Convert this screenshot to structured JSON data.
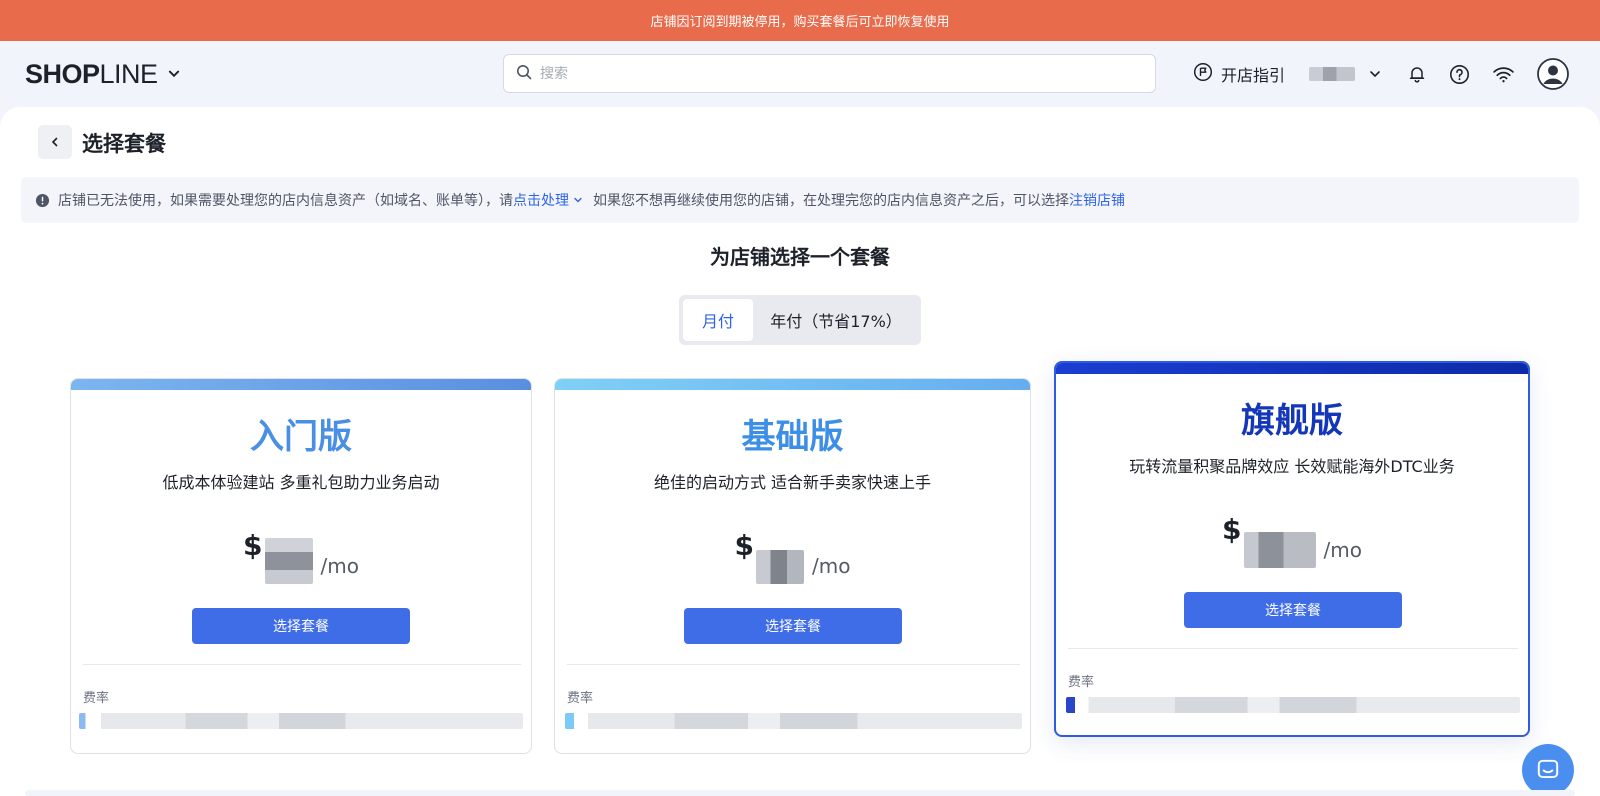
{
  "banner": {
    "text": "店铺因订阅到期被停用，购买套餐后可立即恢复使用"
  },
  "header": {
    "logo_bold": "SHOP",
    "logo_thin": "LINE",
    "search_placeholder": "搜索",
    "guide_label": "开店指引"
  },
  "page": {
    "title": "选择套餐"
  },
  "notice": {
    "text_before": "店铺已无法使用，如果需要处理您的店内信息资产（如域名、账单等），请",
    "action_link": "点击处理",
    "text_middle": "如果您不想再继续使用您的店铺，在处理完您的店内信息资产之后，可以选择",
    "close_link": "注销店铺"
  },
  "plans_section": {
    "title": "为店铺选择一个套餐",
    "billing_toggle": {
      "monthly": "月付",
      "yearly": "年付（节省17%）",
      "selected": "monthly"
    }
  },
  "plans": [
    {
      "name": "入门版",
      "desc": "低成本体验建站 多重礼包助力业务启动",
      "currency": "$",
      "period": "/mo",
      "button": "选择套餐",
      "rate_label": "费率",
      "name_color": "#4a8fe6",
      "bar_color_start": "#7cb6f0",
      "bar_color_end": "#5a8fe0"
    },
    {
      "name": "基础版",
      "desc": "绝佳的启动方式 适合新手卖家快速上手",
      "currency": "$",
      "period": "/mo",
      "button": "选择套餐",
      "rate_label": "费率",
      "name_color": "#3d8fe6",
      "bar_color_start": "#7fd0f7",
      "bar_color_end": "#64aef0"
    },
    {
      "name": "旗舰版",
      "desc": "玩转流量积聚品牌效应 长效赋能海外DTC业务",
      "currency": "$",
      "period": "/mo",
      "button": "选择套餐",
      "rate_label": "费率",
      "name_color": "#1436b8",
      "bar_color_start": "#1a3ed1",
      "bar_color_end": "#0d2aa8"
    }
  ],
  "colors": {
    "banner": "#e86b4b",
    "primary_button": "#3f6de8",
    "link": "#2e63ea",
    "featured_border": "#2f5be0"
  }
}
